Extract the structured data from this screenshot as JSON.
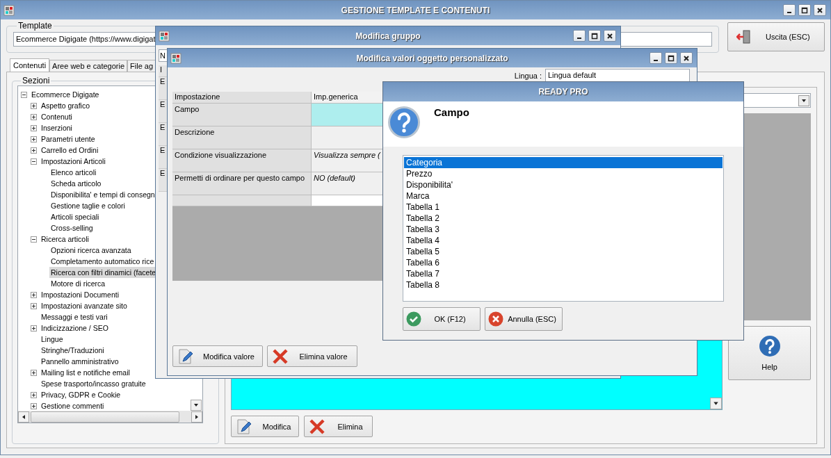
{
  "main_window": {
    "title": "GESTIONE TEMPLATE E CONTENUTI",
    "template": {
      "label": "Template",
      "value": "Ecommerce Digigate (https://www.digigat"
    },
    "exit_button": "Uscita (ESC)",
    "tabs": [
      {
        "label": "Contenuti",
        "selected": true
      },
      {
        "label": "Aree web e categorie",
        "selected": false
      },
      {
        "label": "File ag",
        "selected": false
      }
    ],
    "sections": {
      "label": "Sezioni",
      "tree": [
        {
          "label": "Ecommerce Digigate",
          "expanded": true,
          "selected": false,
          "children": [
            {
              "label": "Aspetto grafico",
              "expanded": false,
              "selected": false
            },
            {
              "label": "Contenuti",
              "expanded": false,
              "selected": false
            },
            {
              "label": "Inserzioni",
              "expanded": false,
              "selected": false
            },
            {
              "label": "Parametri utente",
              "expanded": false,
              "selected": false
            },
            {
              "label": "Carrello ed Ordini",
              "expanded": false,
              "selected": false
            },
            {
              "label": "Impostazioni Articoli",
              "expanded": true,
              "selected": false,
              "children": [
                {
                  "label": "Elenco articoli",
                  "selected": false
                },
                {
                  "label": "Scheda articolo",
                  "selected": false
                },
                {
                  "label": "Disponibilita' e tempi di consegn",
                  "selected": false
                },
                {
                  "label": "Gestione taglie e colori",
                  "selected": false
                },
                {
                  "label": "Articoli speciali",
                  "selected": false
                },
                {
                  "label": "Cross-selling",
                  "selected": false
                }
              ]
            },
            {
              "label": "Ricerca articoli",
              "expanded": true,
              "selected": false,
              "children": [
                {
                  "label": "Opzioni ricerca avanzata",
                  "selected": false
                },
                {
                  "label": "Completamento automatico rice",
                  "selected": false
                },
                {
                  "label": "Ricerca con filtri dinamici (facete",
                  "selected": true
                },
                {
                  "label": "Motore di ricerca",
                  "selected": false
                }
              ]
            },
            {
              "label": "Impostazioni Documenti",
              "expanded": false,
              "selected": false
            },
            {
              "label": "Impostazioni avanzate sito",
              "expanded": false,
              "selected": false
            },
            {
              "label": "Messaggi e testi vari",
              "selected": false
            },
            {
              "label": "Indicizzazione / SEO",
              "expanded": false,
              "selected": false
            },
            {
              "label": "Lingue",
              "selected": false
            },
            {
              "label": "Stringhe/Traduzioni",
              "selected": false
            },
            {
              "label": "Pannello amministrativo",
              "selected": false
            },
            {
              "label": "Mailing list e notifiche email",
              "expanded": false,
              "selected": false
            },
            {
              "label": "Spese trasporto/incasso gratuite",
              "selected": false
            },
            {
              "label": "Privacy, GDPR e Cookie",
              "expanded": false,
              "selected": false
            },
            {
              "label": "Gestione commenti",
              "expanded": false,
              "selected": false
            }
          ]
        }
      ]
    },
    "help_button": "Help",
    "buttons": [
      {
        "label": "Modifica",
        "kind": "edit"
      },
      {
        "label": "Elimina",
        "kind": "delete"
      }
    ]
  },
  "group_window": {
    "title": "Modifica gruppo",
    "field_1": "N",
    "table": {
      "column_1": "I",
      "rows": [
        "E",
        "E",
        "E",
        "E",
        "E"
      ]
    }
  },
  "values_window": {
    "title": "Modifica valori oggetto personalizzato",
    "language": {
      "label": "Lingua :",
      "value": "Lingua default"
    },
    "table": {
      "columns": [
        "Impostazione",
        "Imp.generica"
      ],
      "rows": [
        {
          "setting": "Campo",
          "selected": true
        },
        {
          "setting": "Descrizione",
          "selected": false
        },
        {
          "setting": "Condizione visualizzazione",
          "value": "Visualizza sempre (",
          "selected": false,
          "default": true
        },
        {
          "setting": "Permetti di ordinare per questo campo",
          "value": "NO (default)",
          "selected": false,
          "default": true
        }
      ]
    },
    "buttons": [
      {
        "label": "Modifica valore",
        "kind": "edit"
      },
      {
        "label": "Elimina valore",
        "kind": "delete"
      }
    ]
  },
  "dialog": {
    "title": "READY PRO",
    "heading": "Campo",
    "options": [
      {
        "label": "Categoria",
        "selected": true
      },
      {
        "label": "Prezzo",
        "selected": false
      },
      {
        "label": "Disponibilita'",
        "selected": false
      },
      {
        "label": "Marca",
        "selected": false
      },
      {
        "label": "Tabella 1",
        "selected": false
      },
      {
        "label": "Tabella 2",
        "selected": false
      },
      {
        "label": "Tabella 3",
        "selected": false
      },
      {
        "label": "Tabella 4",
        "selected": false
      },
      {
        "label": "Tabella 5",
        "selected": false
      },
      {
        "label": "Tabella 6",
        "selected": false
      },
      {
        "label": "Tabella 7",
        "selected": false
      },
      {
        "label": "Tabella 8",
        "selected": false
      }
    ],
    "buttons": [
      {
        "label": "OK (F12)",
        "kind": "ok"
      },
      {
        "label": "Annulla (ESC)",
        "kind": "cancel"
      }
    ]
  }
}
